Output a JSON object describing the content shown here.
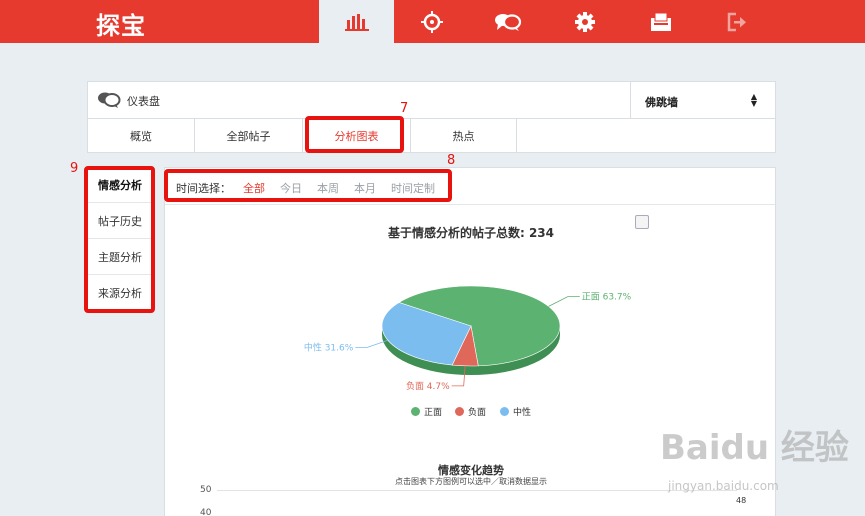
{
  "app": {
    "logo": "探宝"
  },
  "nav": [
    {
      "icon": "bar-chart-icon"
    },
    {
      "icon": "crosshair-icon"
    },
    {
      "icon": "chat-bubbles-icon"
    },
    {
      "icon": "gear-icon"
    },
    {
      "icon": "inbox-icon"
    },
    {
      "icon": "logout-icon"
    }
  ],
  "header": {
    "title": "仪表盘",
    "select_value": "佛跳墙",
    "tabs": [
      "概览",
      "全部帖子",
      "分析图表",
      "热点"
    ]
  },
  "annotations": {
    "tabs": "7",
    "filter": "8",
    "sidebar": "9"
  },
  "sidebar": {
    "items": [
      "情感分析",
      "帖子历史",
      "主题分析",
      "来源分析"
    ]
  },
  "filter": {
    "label": "时间选择：",
    "options": [
      "全部",
      "今日",
      "本周",
      "本月",
      "时间定制"
    ]
  },
  "colors": {
    "brand": "#e63a2e",
    "positive": "#5cb270",
    "negative": "#e0685a",
    "neutral": "#7cbdf0"
  },
  "chart_data": [
    {
      "type": "pie",
      "title": "基于情感分析的帖子总数: 234",
      "slices": [
        {
          "name": "正面",
          "value": 63.7,
          "label": "正面 63.7%"
        },
        {
          "name": "负面",
          "value": 4.7,
          "label": "负面 4.7%"
        },
        {
          "name": "中性",
          "value": 31.6,
          "label": "中性 31.6%"
        }
      ],
      "legend": [
        "正面",
        "负面",
        "中性"
      ]
    },
    {
      "type": "line",
      "title": "情感变化趋势",
      "subtitle": "点击图表下方图例可以选中／取消数据显示",
      "ytick_labels": [
        "50",
        "40"
      ],
      "point_label": "48"
    }
  ],
  "watermark": {
    "text": "Baidu 经验",
    "url": "jingyan.baidu.com"
  }
}
